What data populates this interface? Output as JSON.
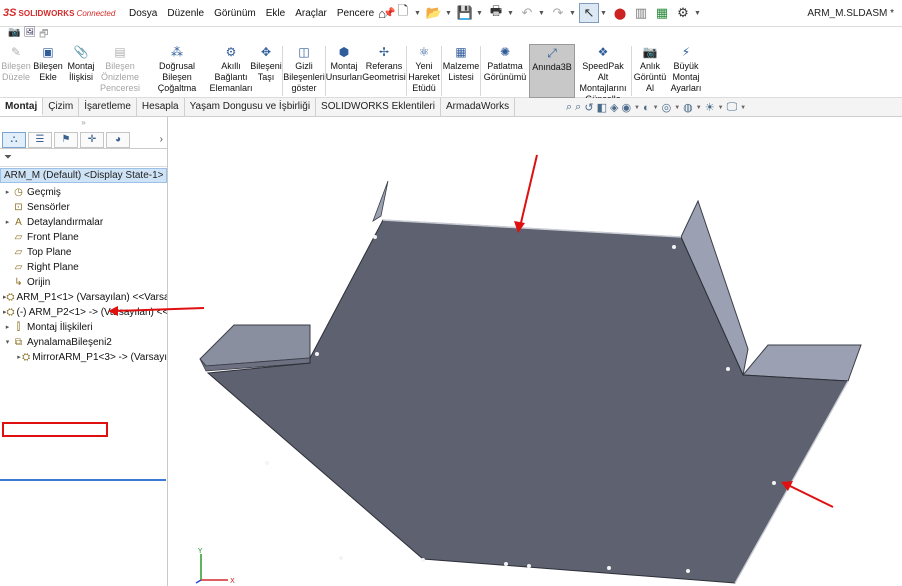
{
  "app": {
    "logo_ds": "3S",
    "logo_brand": "SOLIDWORKS",
    "logo_connected": "Connected",
    "document_title": "ARM_M.SLDASM *"
  },
  "menu": [
    "Dosya",
    "Düzenle",
    "Görünüm",
    "Ekle",
    "Araçlar",
    "Pencere"
  ],
  "commands": [
    {
      "label": "Bileşen\nDüzele",
      "icon": "edit-component-icon",
      "disabled": true
    },
    {
      "label": "Bileşen\nEkle",
      "icon": "insert-component-icon",
      "disabled": false
    },
    {
      "label": "Montaj\nİlişkisi",
      "icon": "mate-icon",
      "disabled": false
    },
    {
      "label": "Bileşen\nÖnizleme\nPenceresi",
      "icon": "component-preview-icon",
      "disabled": true
    },
    {
      "label": "Doğrusal Bileşen\nÇoğaltma",
      "icon": "linear-pattern-icon",
      "disabled": false
    },
    {
      "label": "Akıllı\nBağlantı\nElemanları",
      "icon": "smart-fasteners-icon",
      "disabled": false
    },
    {
      "label": "Bileşeni\nTaşı",
      "icon": "move-component-icon",
      "disabled": false
    },
    {
      "label": "Gizli\nBileşenleri\ngöster",
      "icon": "show-hidden-icon",
      "disabled": false
    },
    {
      "label": "Montaj\nUnsurları",
      "icon": "assembly-features-icon",
      "disabled": false
    },
    {
      "label": "Referans\nGeometrisi",
      "icon": "reference-geometry-icon",
      "disabled": false
    },
    {
      "label": "Yeni\nHareket\nEtüdü",
      "icon": "motion-study-icon",
      "disabled": false
    },
    {
      "label": "Malzeme\nListesi",
      "icon": "bom-icon",
      "disabled": false
    },
    {
      "label": "Patlatma\nGörünümü",
      "icon": "exploded-view-icon",
      "disabled": false
    },
    {
      "label": "Anında3B",
      "icon": "instant3d-icon",
      "disabled": false,
      "active": true
    },
    {
      "label": "SpeedPak Alt\nMontajlarını\nGüncelle",
      "icon": "speedpak-icon",
      "disabled": false
    },
    {
      "label": "Anlık\nGörüntü\nAl",
      "icon": "snapshot-icon",
      "disabled": false
    },
    {
      "label": "Büyük\nMontaj\nAyarları",
      "icon": "large-assembly-icon",
      "disabled": false
    }
  ],
  "tabs": [
    "Montaj",
    "Çizim",
    "İşaretleme",
    "Hesapla",
    "Yaşam Dongusu ve İşbirliği",
    "SOLIDWORKS Eklentileri",
    "ArmadaWorks"
  ],
  "tree": {
    "root": "ARM_M (Default) <Display State-1>",
    "items": [
      {
        "label": "Geçmiş",
        "icon": "history-icon",
        "expand": true
      },
      {
        "label": "Sensörler",
        "icon": "sensors-icon",
        "expand": false
      },
      {
        "label": "Detaylandırmalar",
        "icon": "annotations-icon",
        "expand": true
      },
      {
        "label": "Front Plane",
        "icon": "plane-icon",
        "expand": false
      },
      {
        "label": "Top Plane",
        "icon": "plane-icon",
        "expand": false
      },
      {
        "label": "Right Plane",
        "icon": "plane-icon",
        "expand": false
      },
      {
        "label": "Orijin",
        "icon": "origin-icon",
        "expand": false
      },
      {
        "label": "ARM_P1<1> (Varsayılan) <<Varsa",
        "icon": "part-icon",
        "expand": true
      },
      {
        "label": "(-) ARM_P2<1> -> (Varsayılan) <<",
        "icon": "part-icon",
        "expand": true
      },
      {
        "label": "Montaj İlişkileri",
        "icon": "mates-folder-icon",
        "expand": true
      },
      {
        "label": "AynalamaBileşeni2",
        "icon": "mirror-component-icon",
        "expand": true,
        "open": true
      },
      {
        "label": "MirrorARM_P1<3> -> (Varsayı",
        "icon": "part-icon",
        "expand": true,
        "child": true
      }
    ]
  },
  "colors": {
    "accent_red": "#e01010",
    "plate_face": "#5d6170",
    "flange_face": "#8a8fa0",
    "selection_blue": "#cfe3f6"
  }
}
